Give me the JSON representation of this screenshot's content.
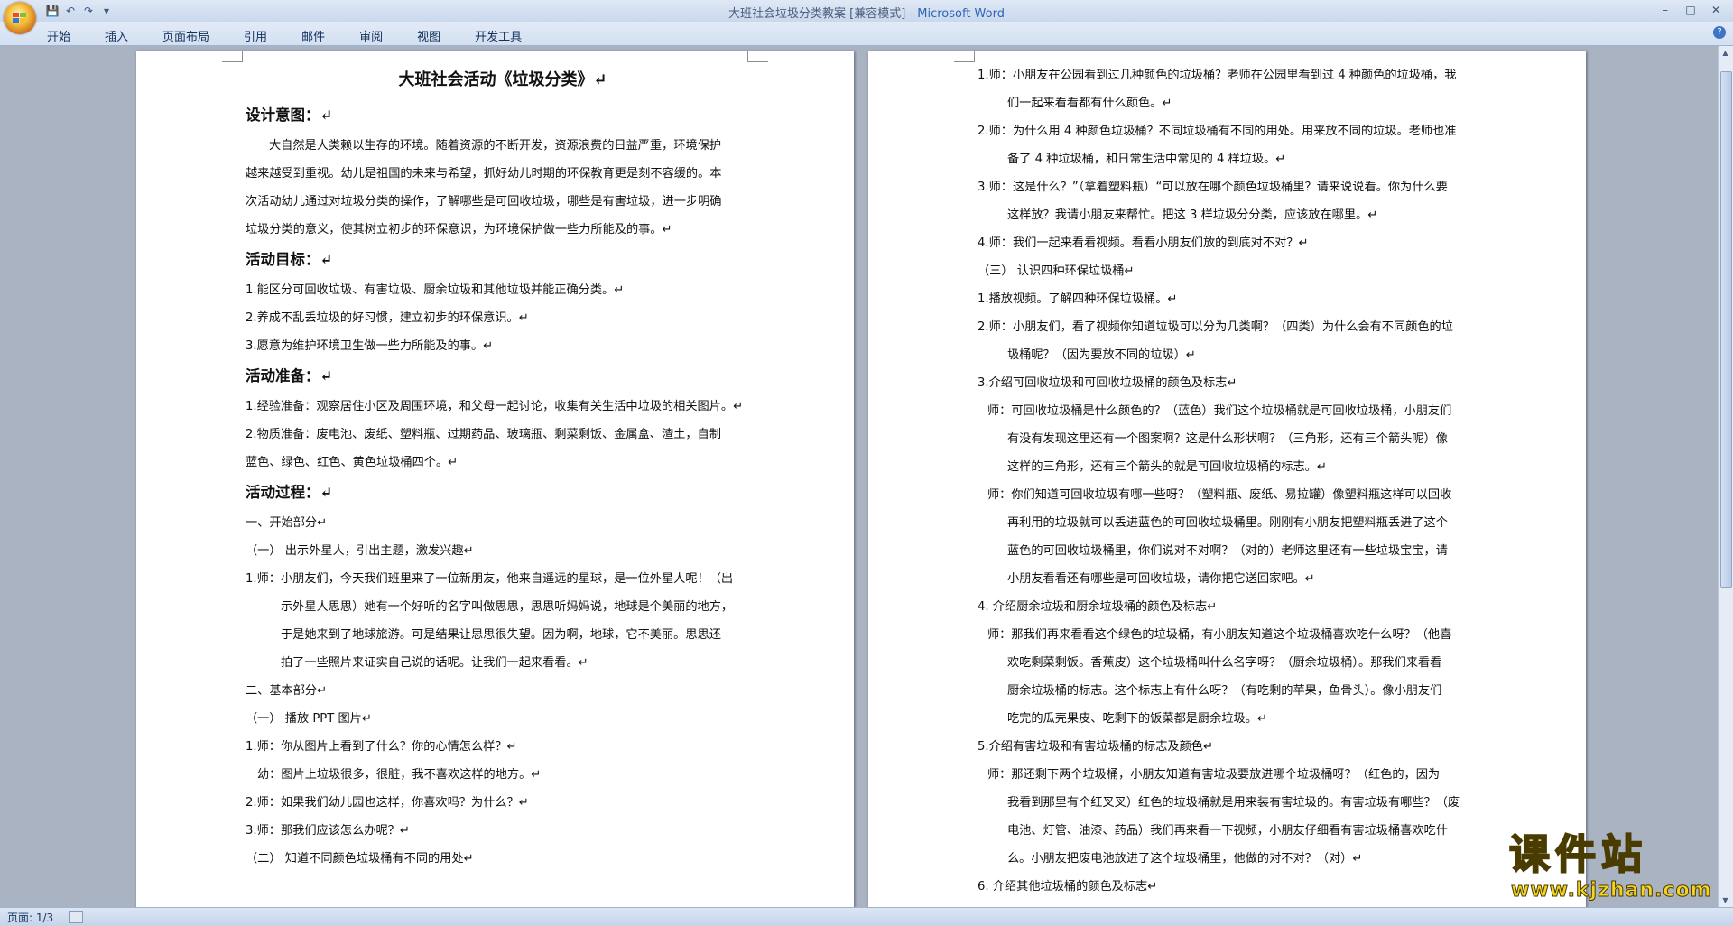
{
  "window": {
    "title_doc": "大班社会垃圾分类教案 [兼容模式] - ",
    "title_app": "Microsoft Word"
  },
  "qat": [
    "save-icon",
    "undo-icon",
    "redo-icon",
    "customize-icon"
  ],
  "ribbon": {
    "tabs": [
      "开始",
      "插入",
      "页面布局",
      "引用",
      "邮件",
      "审阅",
      "视图",
      "开发工具"
    ]
  },
  "left_page": {
    "title": "大班社会活动《垃圾分类》↵",
    "lines": [
      {
        "t": "h2",
        "text": "设计意图：↵"
      },
      {
        "t": "p",
        "text": "大自然是人类赖以生存的环境。随着资源的不断开发，资源浪费的日益严重，环境保护",
        "indent": 2
      },
      {
        "t": "p",
        "text": "越来越受到重视。幼儿是祖国的未来与希望，抓好幼儿时期的环保教育更是刻不容缓的。本"
      },
      {
        "t": "p",
        "text": "次活动幼儿通过对垃圾分类的操作，了解哪些是可回收垃圾，哪些是有害垃圾，进一步明确"
      },
      {
        "t": "p",
        "text": "垃圾分类的意义，使其树立初步的环保意识，为环境保护做一些力所能及的事。↵"
      },
      {
        "t": "h2",
        "text": "活动目标：↵"
      },
      {
        "t": "p",
        "text": "1.能区分可回收垃圾、有害垃圾、厨余垃圾和其他垃圾并能正确分类。↵"
      },
      {
        "t": "p",
        "text": "2.养成不乱丢垃圾的好习惯，建立初步的环保意识。↵"
      },
      {
        "t": "p",
        "text": "3.愿意为维护环境卫生做一些力所能及的事。↵"
      },
      {
        "t": "h2",
        "text": "活动准备：↵"
      },
      {
        "t": "p",
        "text": "1.经验准备：观察居住小区及周围环境，和父母一起讨论，收集有关生活中垃圾的相关图片。↵"
      },
      {
        "t": "p",
        "text": "2.物质准备：废电池、废纸、塑料瓶、过期药品、玻璃瓶、剩菜剩饭、金属盒、渣土，自制"
      },
      {
        "t": "p",
        "text": "蓝色、绿色、红色、黄色垃圾桶四个。↵"
      },
      {
        "t": "h2",
        "text": "活动过程：↵"
      },
      {
        "t": "p",
        "text": "一、开始部分↵"
      },
      {
        "t": "p",
        "text": "（一） 出示外星人，引出主题，激发兴趣↵"
      },
      {
        "t": "p",
        "text": "1.师：小朋友们，今天我们班里来了一位新朋友，他来自遥远的星球，是一位外星人呢！（出"
      },
      {
        "t": "p",
        "text": "示外星人思思）她有一个好听的名字叫做思思，思思听妈妈说，地球是个美丽的地方，",
        "indent": 3
      },
      {
        "t": "p",
        "text": "于是她来到了地球旅游。可是结果让思思很失望。因为啊，地球，它不美丽。思思还",
        "indent": 3
      },
      {
        "t": "p",
        "text": "拍了一些照片来证实自己说的话呢。让我们一起来看看。↵",
        "indent": 3
      },
      {
        "t": "p",
        "text": "二、基本部分↵"
      },
      {
        "t": "p",
        "text": "（一） 播放 PPT 图片↵"
      },
      {
        "t": "p",
        "text": "1.师：你从图片上看到了什么？你的心情怎么样？↵"
      },
      {
        "t": "p",
        "text": "幼：图片上垃圾很多，很脏，我不喜欢这样的地方。↵",
        "indent": 1
      },
      {
        "t": "p",
        "text": "2.师：如果我们幼儿园也这样，你喜欢吗？为什么？↵"
      },
      {
        "t": "p",
        "text": "3.师：那我们应该怎么办呢？↵"
      },
      {
        "t": "p",
        "text": "（二） 知道不同颜色垃圾桶有不同的用处↵"
      }
    ]
  },
  "right_page": {
    "lines": [
      {
        "text": "1.师：小朋友在公园看到过几种颜色的垃圾桶？老师在公园里看到过 4 种颜色的垃圾桶，我",
        "indent": 0
      },
      {
        "text": "们一起来看看都有什么颜色。↵",
        "indent": 3
      },
      {
        "text": "2.师：为什么用 4 种颜色垃圾桶？不同垃圾桶有不同的用处。用来放不同的垃圾。老师也准",
        "indent": 0
      },
      {
        "text": "备了 4 种垃圾桶，和日常生活中常见的 4 样垃圾。↵",
        "indent": 3
      },
      {
        "text": "3.师：这是什么？”（拿着塑料瓶）“可以放在哪个颜色垃圾桶里？请来说说看。你为什么要",
        "indent": 0
      },
      {
        "text": "这样放？我请小朋友来帮忙。把这 3 样垃圾分分类，应该放在哪里。↵",
        "indent": 3
      },
      {
        "text": "4.师：我们一起来看看视频。看看小朋友们放的到底对不对？↵",
        "indent": 0
      },
      {
        "text": "（三） 认识四种环保垃圾桶↵",
        "indent": 0
      },
      {
        "text": "1.播放视频。了解四种环保垃圾桶。↵",
        "indent": 0
      },
      {
        "text": "2.师：小朋友们，看了视频你知道垃圾可以分为几类啊？（四类）为什么会有不同颜色的垃",
        "indent": 0
      },
      {
        "text": "圾桶呢？（因为要放不同的垃圾）↵",
        "indent": 3
      },
      {
        "text": "3.介绍可回收垃圾和可回收垃圾桶的颜色及标志↵",
        "indent": 0
      },
      {
        "text": "师：可回收垃圾桶是什么颜色的？（蓝色）我们这个垃圾桶就是可回收垃圾桶，小朋友们",
        "indent": 1
      },
      {
        "text": "有没有发现这里还有一个图案啊？这是什么形状啊？（三角形，还有三个箭头呢）像",
        "indent": 3
      },
      {
        "text": "这样的三角形，还有三个箭头的就是可回收垃圾桶的标志。↵",
        "indent": 3
      },
      {
        "text": "师：你们知道可回收垃圾有哪一些呀？（塑料瓶、废纸、易拉罐）像塑料瓶这样可以回收",
        "indent": 1
      },
      {
        "text": "再利用的垃圾就可以丢进蓝色的可回收垃圾桶里。刚刚有小朋友把塑料瓶丢进了这个",
        "indent": 3
      },
      {
        "text": "蓝色的可回收垃圾桶里，你们说对不对啊？（对的）老师这里还有一些垃圾宝宝，请",
        "indent": 3
      },
      {
        "text": "小朋友看看还有哪些是可回收垃圾，请你把它送回家吧。↵",
        "indent": 3
      },
      {
        "text": "4. 介绍厨余垃圾和厨余垃圾桶的颜色及标志↵",
        "indent": 0
      },
      {
        "text": "师：那我们再来看看这个绿色的垃圾桶，有小朋友知道这个垃圾桶喜欢吃什么呀？（他喜",
        "indent": 1
      },
      {
        "text": "欢吃剩菜剩饭。香蕉皮）这个垃圾桶叫什么名字呀？（厨余垃圾桶）。那我们来看看",
        "indent": 3
      },
      {
        "text": "厨余垃圾桶的标志。这个标志上有什么呀？（有吃剩的苹果，鱼骨头）。像小朋友们",
        "indent": 3
      },
      {
        "text": "吃完的瓜壳果皮、吃剩下的饭菜都是厨余垃圾。↵",
        "indent": 3
      },
      {
        "text": "5.介绍有害垃圾和有害垃圾桶的标志及颜色↵",
        "indent": 0
      },
      {
        "text": "师：那还剩下两个垃圾桶，小朋友知道有害垃圾要放进哪个垃圾桶呀？（红色的，因为",
        "indent": 1
      },
      {
        "text": "我看到那里有个红叉叉）红色的垃圾桶就是用来装有害垃圾的。有害垃圾有哪些？（废",
        "indent": 3
      },
      {
        "text": "电池、灯管、油漆、药品）我们再来看一下视频，小朋友仔细看有害垃圾桶喜欢吃什",
        "indent": 3
      },
      {
        "text": "么。小朋友把废电池放进了这个垃圾桶里，他做的对不对？（对）↵",
        "indent": 3
      },
      {
        "text": "6. 介绍其他垃圾桶的颜色及标志↵",
        "indent": 0
      }
    ]
  },
  "status": {
    "page": "页面: 1/3"
  },
  "watermark": {
    "main": "课件站",
    "url": "www.kjzhan.com"
  }
}
